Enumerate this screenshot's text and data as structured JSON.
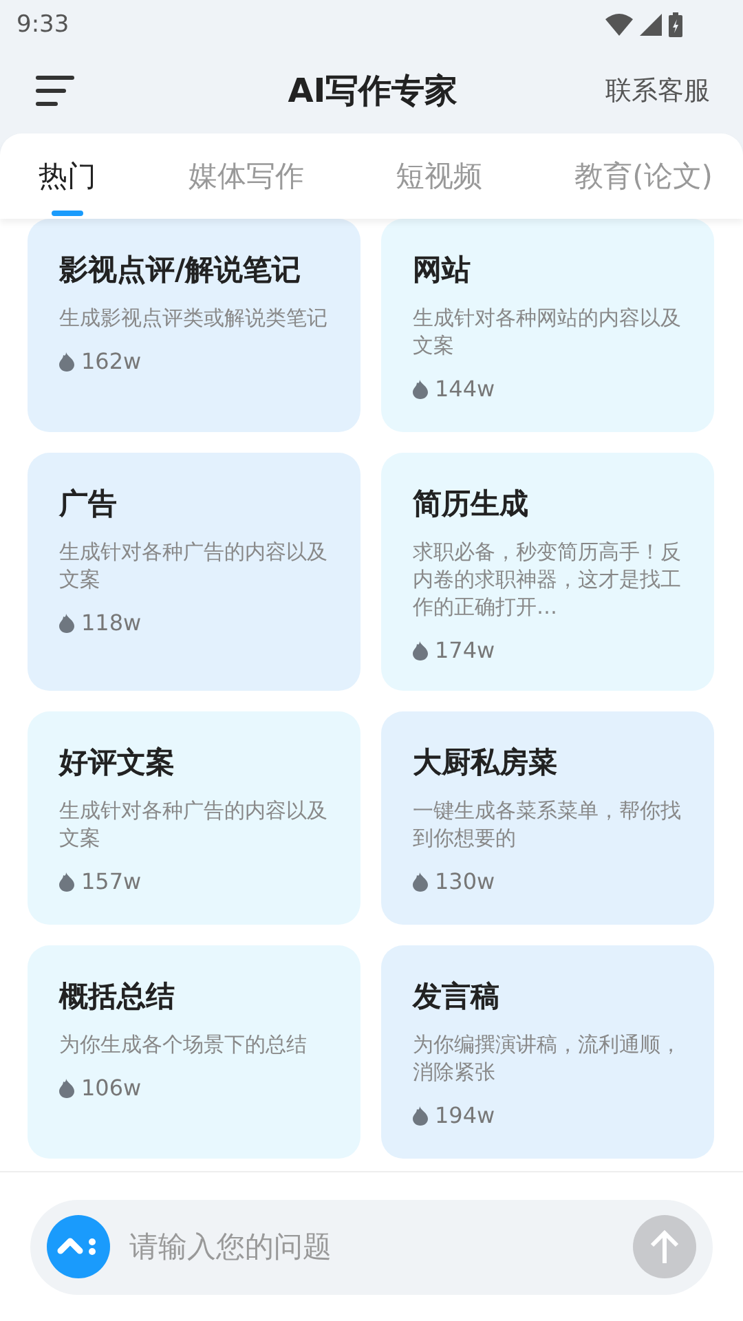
{
  "status_bar": {
    "time": "9:33"
  },
  "header": {
    "title": "AI写作专家",
    "action": "联系客服"
  },
  "tabs": [
    {
      "label": "热门",
      "selected": true
    },
    {
      "label": "媒体写作",
      "selected": false
    },
    {
      "label": "短视频",
      "selected": false
    },
    {
      "label": "教育(论文)",
      "selected": false
    }
  ],
  "cards": [
    {
      "title": "影视点评/解说笔记",
      "description": "生成影视点评类或解说类笔记",
      "count": "162w",
      "color": "#e3f1fd"
    },
    {
      "title": "网站",
      "description": "生成针对各种网站的内容以及文案",
      "count": "144w",
      "color": "#e8f8fe"
    },
    {
      "title": "广告",
      "description": "生成针对各种广告的内容以及文案",
      "count": "118w",
      "color": "#e3f1fd"
    },
    {
      "title": "简历生成",
      "description": "求职必备，秒变简历高手！反内卷的求职神器，这才是找工作的正确打开…",
      "count": "174w",
      "color": "#e8f8fe"
    },
    {
      "title": "好评文案",
      "description": "生成针对各种广告的内容以及文案",
      "count": "157w",
      "color": "#e8f8fe"
    },
    {
      "title": "大厨私房菜",
      "description": "一键生成各菜系菜单，帮你找到你想要的",
      "count": "130w",
      "color": "#e3f1fd"
    },
    {
      "title": "概括总结",
      "description": "为你生成各个场景下的总结",
      "count": "106w",
      "color": "#e8f8fe"
    },
    {
      "title": "发言稿",
      "description": "为你编撰演讲稿，流利通顺，消除紧张",
      "count": "194w",
      "color": "#e3f1fd"
    }
  ],
  "input": {
    "placeholder": "请输入您的问题"
  }
}
